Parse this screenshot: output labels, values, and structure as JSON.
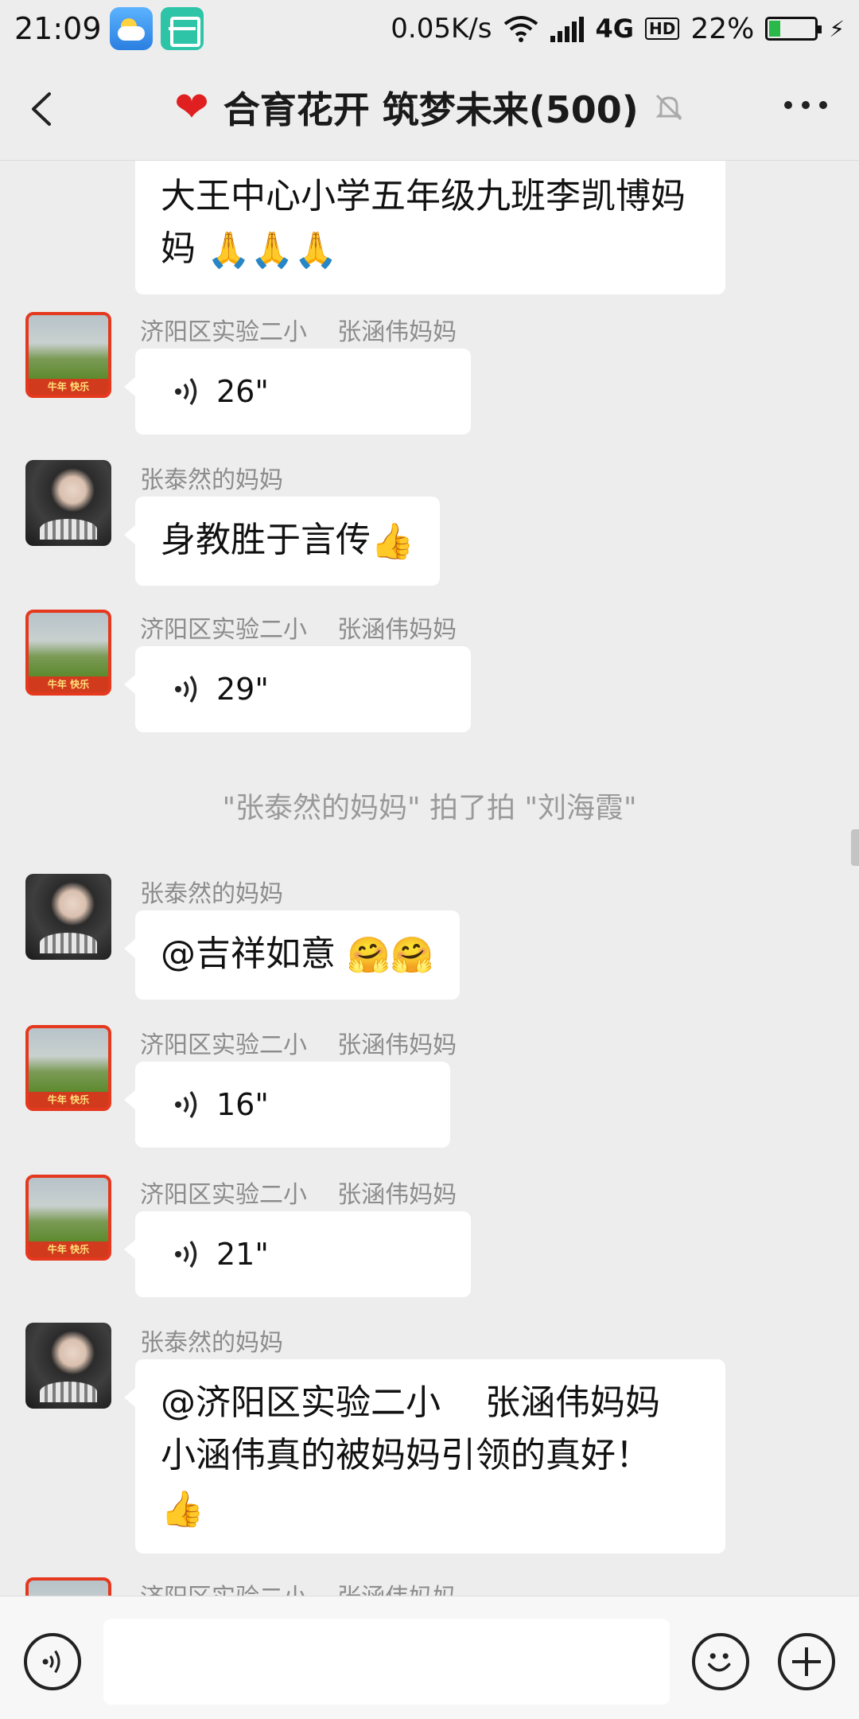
{
  "status_bar": {
    "time": "21:09",
    "net_speed": "0.05K/s",
    "network": "4G",
    "hd": "HD",
    "battery": "22%",
    "battery_level": 0.22
  },
  "header": {
    "title": "合育花开 筑梦未来(500)",
    "title_icon": "❤"
  },
  "messages": {
    "m0_text_line1": "大王中心小学五年级九班李凯博妈",
    "m0_text_line2": "妈",
    "m0_emoji": "🙏🙏🙏",
    "m1_sender": "济阳区实验二小    张涵伟妈妈",
    "m1_voice": "26\"",
    "m2_sender": "张泰然的妈妈",
    "m2_text": "身教胜于言传",
    "m2_emoji": "👍",
    "m3_sender": "济阳区实验二小    张涵伟妈妈",
    "m3_voice": "29\"",
    "system": "\"张泰然的妈妈\" 拍了拍 \"刘海霞\"",
    "m4_sender": "张泰然的妈妈",
    "m4_text": "@吉祥如意",
    "m4_emoji": "🤗🤗",
    "m5_sender": "济阳区实验二小    张涵伟妈妈",
    "m5_voice": "16\"",
    "m6_sender": "济阳区实验二小    张涵伟妈妈",
    "m6_voice": "21\"",
    "m7_sender": "张泰然的妈妈",
    "m7_line1": "@济阳区实验二小    张涵伟妈妈",
    "m7_line2": "小涵伟真的被妈妈引领的真好！",
    "m7_emoji": "👍",
    "m8_sender": "济阳区实验二小    张涵伟妈妈"
  },
  "avatars": {
    "school_banner": "牛年 快乐"
  },
  "input": {
    "placeholder": ""
  },
  "colors": {
    "background": "#ededed",
    "bubble": "#ffffff",
    "heart": "#e02020",
    "avatar_border": "#e5391f"
  }
}
